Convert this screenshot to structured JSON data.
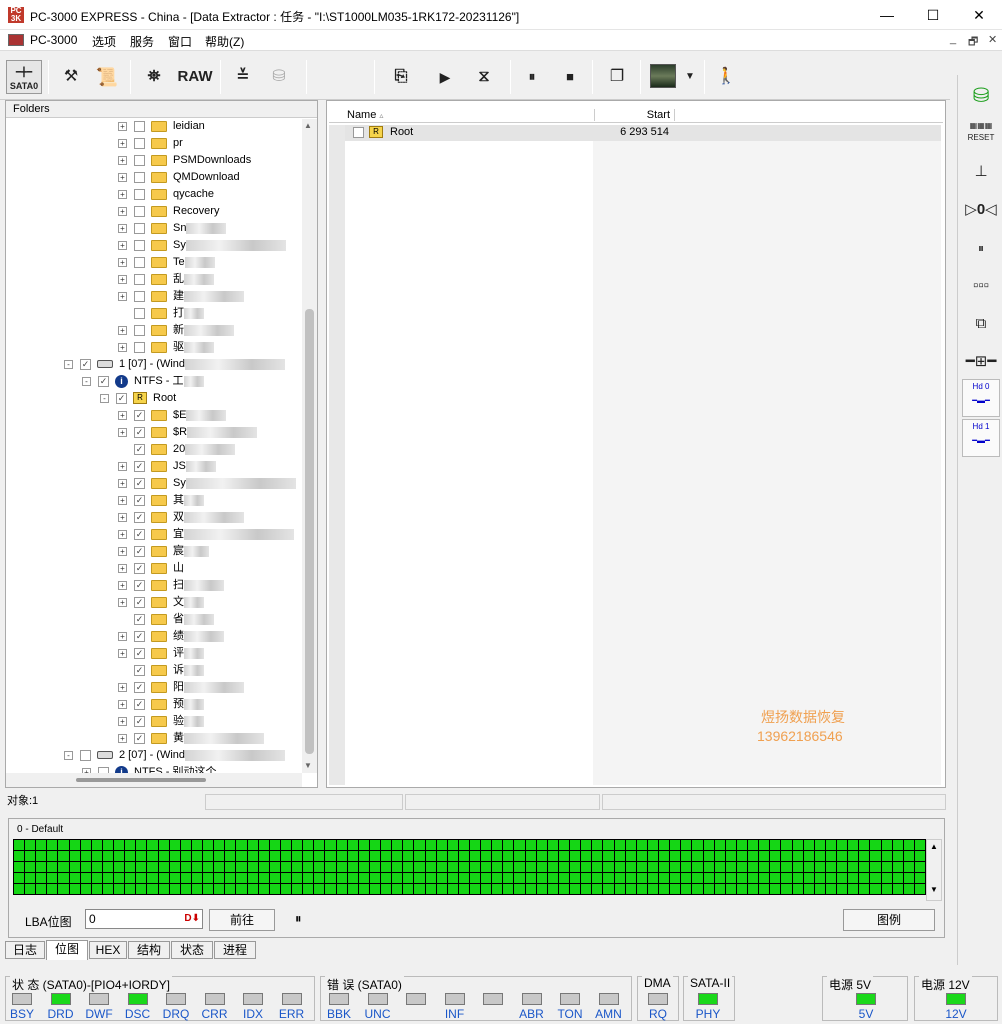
{
  "window": {
    "title": "PC-3000 EXPRESS - China - [Data Extractor : 任务 - \"I:\\ST1000LM035-1RK172-20231126\"]",
    "app_icon": "pc3000-icon",
    "minimize": "—",
    "maximize": "☐",
    "close": "✕"
  },
  "menu": {
    "app": "PC-3000",
    "items": [
      "选项",
      "服务",
      "窗口",
      "帮助(Z)"
    ],
    "mdi": [
      "_",
      "🗗",
      "✕"
    ]
  },
  "toolbar": {
    "sata_label": "SATA0",
    "raw_label": "RAW"
  },
  "folders": {
    "header": "Folders",
    "rows": [
      {
        "text": "leidian",
        "level": 3,
        "exp": "+",
        "check": "",
        "blur": 0
      },
      {
        "text": "pr",
        "level": 3,
        "exp": "+",
        "check": "",
        "blur": 0
      },
      {
        "text": "PSMDownloads",
        "level": 3,
        "exp": "+",
        "check": "",
        "blur": 0
      },
      {
        "text": "QMDownload",
        "level": 3,
        "exp": "+",
        "check": "",
        "blur": 0
      },
      {
        "text": "qycache",
        "level": 3,
        "exp": "+",
        "check": "",
        "blur": 0
      },
      {
        "text": "Recovery",
        "level": 3,
        "exp": "+",
        "check": "",
        "blur": 0
      },
      {
        "text": "Sn",
        "level": 3,
        "exp": "+",
        "check": "",
        "blur": 40
      },
      {
        "text": "Sy",
        "level": 3,
        "exp": "+",
        "check": "",
        "blur": 100
      },
      {
        "text": "Te",
        "level": 3,
        "exp": "+",
        "check": "",
        "blur": 30
      },
      {
        "text": "乱",
        "level": 3,
        "exp": "+",
        "check": "",
        "blur": 30
      },
      {
        "text": "建",
        "level": 3,
        "exp": "+",
        "check": "",
        "blur": 60
      },
      {
        "text": "打",
        "level": 3,
        "exp": "",
        "check": "",
        "blur": 20
      },
      {
        "text": "新",
        "level": 3,
        "exp": "+",
        "check": "",
        "blur": 50
      },
      {
        "text": "驱",
        "level": 3,
        "exp": "+",
        "check": "",
        "blur": 30
      },
      {
        "text": "1 [07] - (Wind",
        "level": 0,
        "exp": "-",
        "check": "✓",
        "blur": 100,
        "icon": "disk"
      },
      {
        "text": "NTFS - 工",
        "level": 1,
        "exp": "-",
        "check": "✓",
        "blur": 20,
        "icon": "info"
      },
      {
        "text": "Root",
        "level": 2,
        "exp": "-",
        "check": "✓",
        "blur": 0,
        "icon": "root"
      },
      {
        "text": "$E",
        "level": 3,
        "exp": "+",
        "check": "✓",
        "blur": 40
      },
      {
        "text": "$R",
        "level": 3,
        "exp": "+",
        "check": "✓",
        "blur": 70
      },
      {
        "text": "20",
        "level": 3,
        "exp": "",
        "check": "✓",
        "blur": 50
      },
      {
        "text": "JS",
        "level": 3,
        "exp": "+",
        "check": "✓",
        "blur": 30
      },
      {
        "text": "Sy",
        "level": 3,
        "exp": "+",
        "check": "✓",
        "blur": 110
      },
      {
        "text": "其",
        "level": 3,
        "exp": "+",
        "check": "✓",
        "blur": 20
      },
      {
        "text": "双",
        "level": 3,
        "exp": "+",
        "check": "✓",
        "blur": 60
      },
      {
        "text": "宜",
        "level": 3,
        "exp": "+",
        "check": "✓",
        "blur": 110
      },
      {
        "text": "宸",
        "level": 3,
        "exp": "+",
        "check": "✓",
        "blur": 25
      },
      {
        "text": "山",
        "level": 3,
        "exp": "+",
        "check": "✓",
        "blur": 0
      },
      {
        "text": "扫",
        "level": 3,
        "exp": "+",
        "check": "✓",
        "blur": 40
      },
      {
        "text": "文",
        "level": 3,
        "exp": "+",
        "check": "✓",
        "blur": 20
      },
      {
        "text": "省",
        "level": 3,
        "exp": "",
        "check": "✓",
        "blur": 30
      },
      {
        "text": "绩",
        "level": 3,
        "exp": "+",
        "check": "✓",
        "blur": 40
      },
      {
        "text": "评",
        "level": 3,
        "exp": "+",
        "check": "✓",
        "blur": 20
      },
      {
        "text": "诉",
        "level": 3,
        "exp": "",
        "check": "✓",
        "blur": 20
      },
      {
        "text": "阳",
        "level": 3,
        "exp": "+",
        "check": "✓",
        "blur": 60
      },
      {
        "text": "预",
        "level": 3,
        "exp": "+",
        "check": "✓",
        "blur": 20
      },
      {
        "text": "验",
        "level": 3,
        "exp": "+",
        "check": "✓",
        "blur": 20
      },
      {
        "text": "黄",
        "level": 3,
        "exp": "+",
        "check": "✓",
        "blur": 80
      },
      {
        "text": "2 [07] - (Wind",
        "level": 0,
        "exp": "-",
        "check": "",
        "blur": 100,
        "icon": "disk"
      },
      {
        "text": "NTFS - 别动这个",
        "level": 1,
        "exp": "+",
        "check": "",
        "blur": 0,
        "icon": "info"
      }
    ]
  },
  "list": {
    "col_name": "Name",
    "col_start": "Start",
    "row_name": "Root",
    "row_start": "6 293 514",
    "watermark1": "煜扬数据恢复",
    "watermark2": "13962186546"
  },
  "status": {
    "objects": "对象:1"
  },
  "bitmap": {
    "title": "0 - Default",
    "lba_label": "LBA位图",
    "lba_value": "0",
    "goto": "前往",
    "pause": "⏸",
    "legend": "图例"
  },
  "tabs": [
    "日志",
    "位图",
    "HEX",
    "结构",
    "状态",
    "进程"
  ],
  "indicators": {
    "state_title": "状 态 (SATA0)-[PIO4+IORDY]",
    "state": [
      {
        "l": "BSY",
        "on": false
      },
      {
        "l": "DRD",
        "on": true
      },
      {
        "l": "DWF",
        "on": false
      },
      {
        "l": "DSC",
        "on": true
      },
      {
        "l": "DRQ",
        "on": false
      },
      {
        "l": "CRR",
        "on": false
      },
      {
        "l": "IDX",
        "on": false
      },
      {
        "l": "ERR",
        "on": false
      }
    ],
    "err_title": "错 误 (SATA0)",
    "err": [
      {
        "l": "BBK",
        "on": false
      },
      {
        "l": "UNC",
        "on": false
      },
      {
        "l": "",
        "on": false
      },
      {
        "l": "INF",
        "on": false
      },
      {
        "l": "",
        "on": false
      },
      {
        "l": "ABR",
        "on": false
      },
      {
        "l": "TON",
        "on": false
      },
      {
        "l": "AMN",
        "on": false
      }
    ],
    "dma_title": "DMA",
    "dma": "RQ",
    "sata_title": "SATA-II",
    "sata": "PHY",
    "p5_title": "电源 5V",
    "p5": "5V",
    "p12_title": "电源 12V",
    "p12": "12V"
  },
  "right_toolbar": {
    "reset": "RESET",
    "hd0": "Hd 0",
    "hd1": "Hd 1"
  }
}
